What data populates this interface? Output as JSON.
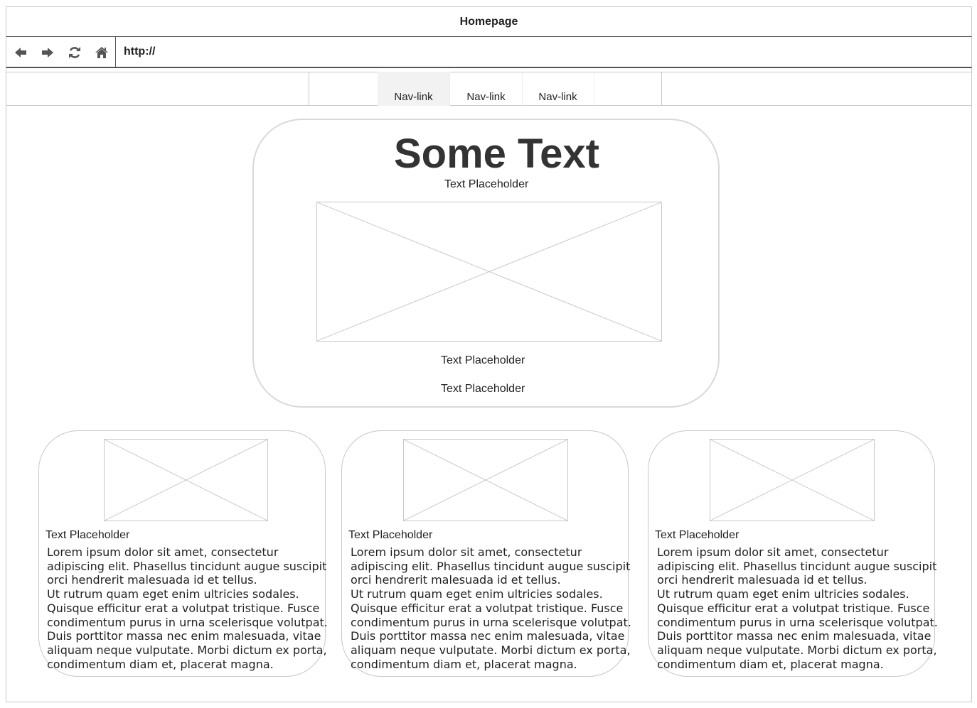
{
  "window": {
    "title": "Homepage"
  },
  "toolbar": {
    "back_icon": "arrow-left-icon",
    "forward_icon": "arrow-right-icon",
    "refresh_icon": "refresh-icon",
    "home_icon": "home-icon",
    "url": "http://"
  },
  "nav": {
    "links": [
      {
        "label": "Nav-link",
        "active": true
      },
      {
        "label": "Nav-link",
        "active": false
      },
      {
        "label": "Nav-link",
        "active": false
      }
    ]
  },
  "hero": {
    "title": "Some Text",
    "subtitle": "Text Placeholder",
    "caption_1": "Text Placeholder",
    "caption_2": "Text Placeholder"
  },
  "cards": [
    {
      "label": "Text Placeholder",
      "text": "Lorem ipsum dolor sit amet, consectetur adipiscing elit. Phasellus tincidunt augue suscipit orci hendrerit malesuada id et tellus.\nUt rutrum quam eget enim ultricies sodales. Quisque efficitur erat a volutpat tristique. Fusce condimentum purus in urna scelerisque volutpat. Duis porttitor massa nec enim malesuada, vitae aliquam neque vulputate. Morbi dictum ex porta, condimentum diam et, placerat magna."
    },
    {
      "label": "Text Placeholder",
      "text": "Lorem ipsum dolor sit amet, consectetur adipiscing elit. Phasellus tincidunt augue suscipit orci hendrerit malesuada id et tellus.\nUt rutrum quam eget enim ultricies sodales. Quisque efficitur erat a volutpat tristique. Fusce condimentum purus in urna scelerisque volutpat. Duis porttitor massa nec enim malesuada, vitae aliquam neque vulputate. Morbi dictum ex porta, condimentum diam et, placerat magna."
    },
    {
      "label": "Text Placeholder",
      "text": "Lorem ipsum dolor sit amet, consectetur adipiscing elit. Phasellus tincidunt augue suscipit orci hendrerit malesuada id et tellus.\nUt rutrum quam eget enim ultricies sodales. Quisque efficitur erat a volutpat tristique. Fusce condimentum purus in urna scelerisque volutpat. Duis porttitor massa nec enim malesuada, vitae aliquam neque vulputate. Morbi dictum ex porta, condimentum diam et, placerat magna."
    }
  ],
  "colors": {
    "border": "#c8c8c8",
    "divider": "#555555",
    "active_nav": "#f2f2f2",
    "title_text": "#333333"
  }
}
